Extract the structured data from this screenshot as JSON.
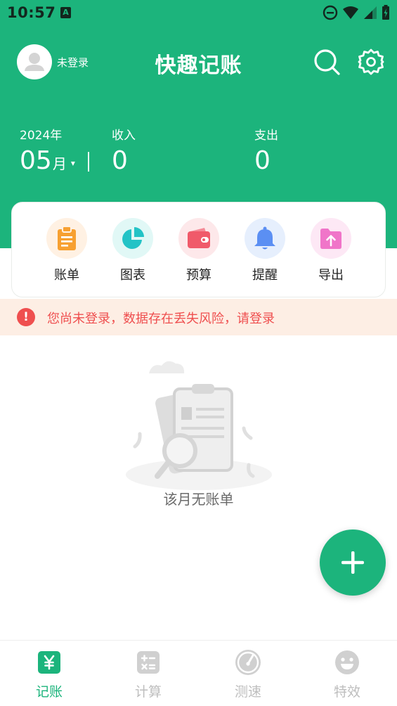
{
  "status_bar": {
    "time": "10:57",
    "a_badge": "A"
  },
  "header": {
    "login_label": "未登录",
    "title": "快趣记账",
    "icons": [
      "user-avatar-icon",
      "search-icon",
      "gear-icon"
    ]
  },
  "summary": {
    "year": "2024年",
    "month": "05",
    "month_unit": "月",
    "caret": "▾",
    "income_label": "收入",
    "income_value": "0",
    "expense_label": "支出",
    "expense_value": "0"
  },
  "actions": [
    {
      "label": "账单",
      "icon": "clipboard-icon",
      "bg": "#fff1e3",
      "color": "#f7a031"
    },
    {
      "label": "图表",
      "icon": "pie-chart-icon",
      "bg": "#e1f8f6",
      "color": "#23c3c6"
    },
    {
      "label": "预算",
      "icon": "wallet-icon",
      "bg": "#fde8ea",
      "color": "#f05a6a"
    },
    {
      "label": "提醒",
      "icon": "bell-icon",
      "bg": "#e6effd",
      "color": "#5b8ff3"
    },
    {
      "label": "导出",
      "icon": "folder-upload-icon",
      "bg": "#fde8f5",
      "color": "#f075c9"
    }
  ],
  "warning": {
    "icon_text": "!",
    "text": "您尚未登录，数据存在丢失风险，请登录"
  },
  "empty_state": {
    "text": "该月无账单"
  },
  "fab": {
    "icon": "plus-icon"
  },
  "nav": [
    {
      "label": "记账",
      "icon": "yen-icon",
      "active": true
    },
    {
      "label": "计算",
      "icon": "calculator-icon",
      "active": false
    },
    {
      "label": "测速",
      "icon": "speedometer-icon",
      "active": false
    },
    {
      "label": "特效",
      "icon": "smiley-icon",
      "active": false
    }
  ],
  "colors": {
    "brand": "#1cb47c",
    "warning": "#ef4f4f",
    "warning_bg": "#fdeee4",
    "nav_inactive": "#bdbdbd"
  }
}
